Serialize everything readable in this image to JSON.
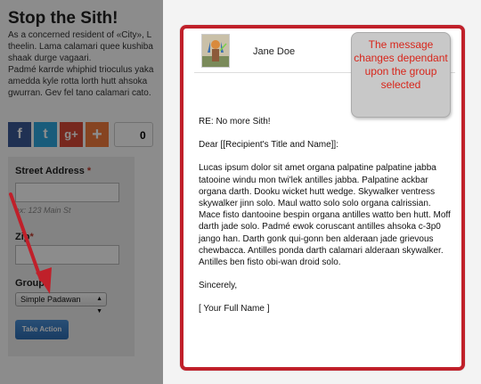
{
  "page": {
    "title": "Stop the Sith!",
    "paragraph_lines": [
      "As a concerned resident of «City», L",
      "theelin. Lama calamari quee kushiba",
      "shaak durge vagaari.",
      "Padmé karrde whiphid trioculus yaka",
      "amedda kyle rotta lorth hutt ahsoka",
      "gwurran. Gev fel tano calamari cato."
    ],
    "share": {
      "facebook_glyph": "f",
      "twitter_glyph": "t",
      "googleplus_glyph": "g+",
      "add_glyph": "+",
      "count": "0"
    },
    "form": {
      "street_label": "Street Address",
      "street_required": "*",
      "street_hint": "ex: 123 Main St",
      "zip_label": "Zip",
      "zip_required": "*",
      "group_label": "Group",
      "group_selected": "Simple Padawan",
      "submit_label": "Take Action"
    }
  },
  "letter": {
    "sender_name": "Jane Doe",
    "subject": "RE: No more Sith!",
    "salutation": "Dear [[Recipient's Title and Name]]:",
    "body": "Lucas ipsum dolor sit amet organa palpatine palpatine jabba tatooine windu mon twi'lek antilles jabba. Palpatine ackbar organa darth. Dooku wicket hutt wedge. Skywalker ventress skywalker jinn solo. Maul watto solo solo organa calrissian. Mace fisto dantooine bespin organa antilles watto ben hutt. Moff darth jade solo. Padmé ewok coruscant antilles ahsoka c-3p0 jango han. Darth gonk qui-gonn ben alderaan jade grievous chewbacca. Antilles ponda darth calamari alderaan skywalker. Antilles ben fisto obi-wan droid solo.",
    "closing": "Sincerely,",
    "signature": "[ Your Full Name ]"
  },
  "callout": {
    "text": "The message changes dependant upon the group selected"
  },
  "colors": {
    "highlight_red": "#c0202a",
    "callout_text": "#d8261b",
    "button_blue": "#2d6db3"
  }
}
